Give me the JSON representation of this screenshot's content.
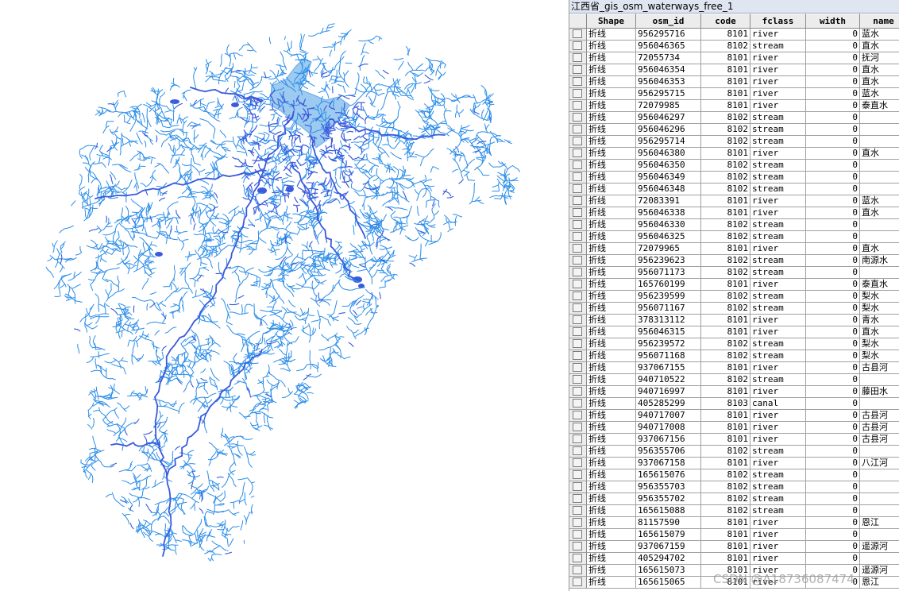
{
  "table": {
    "title": "江西省_gis_osm_waterways_free_1",
    "columns": [
      "Shape",
      "osm_id",
      "code",
      "fclass",
      "width",
      "name"
    ],
    "rows": [
      [
        "折线",
        "956295716",
        "8101",
        "river",
        "0",
        "蓝水"
      ],
      [
        "折线",
        "956046365",
        "8102",
        "stream",
        "0",
        "直水"
      ],
      [
        "折线",
        "72055734",
        "8101",
        "river",
        "0",
        "抚河"
      ],
      [
        "折线",
        "956046354",
        "8101",
        "river",
        "0",
        "直水"
      ],
      [
        "折线",
        "956046353",
        "8101",
        "river",
        "0",
        "直水"
      ],
      [
        "折线",
        "956295715",
        "8101",
        "river",
        "0",
        "蓝水"
      ],
      [
        "折线",
        "72079985",
        "8101",
        "river",
        "0",
        "泰直水"
      ],
      [
        "折线",
        "956046297",
        "8102",
        "stream",
        "0",
        ""
      ],
      [
        "折线",
        "956046296",
        "8102",
        "stream",
        "0",
        ""
      ],
      [
        "折线",
        "956295714",
        "8102",
        "stream",
        "0",
        ""
      ],
      [
        "折线",
        "956046380",
        "8101",
        "river",
        "0",
        "直水"
      ],
      [
        "折线",
        "956046350",
        "8102",
        "stream",
        "0",
        ""
      ],
      [
        "折线",
        "956046349",
        "8102",
        "stream",
        "0",
        ""
      ],
      [
        "折线",
        "956046348",
        "8102",
        "stream",
        "0",
        ""
      ],
      [
        "折线",
        "72083391",
        "8101",
        "river",
        "0",
        "蓝水"
      ],
      [
        "折线",
        "956046338",
        "8101",
        "river",
        "0",
        "直水"
      ],
      [
        "折线",
        "956046330",
        "8102",
        "stream",
        "0",
        ""
      ],
      [
        "折线",
        "956046325",
        "8102",
        "stream",
        "0",
        ""
      ],
      [
        "折线",
        "72079965",
        "8101",
        "river",
        "0",
        "直水"
      ],
      [
        "折线",
        "956239623",
        "8102",
        "stream",
        "0",
        "南源水"
      ],
      [
        "折线",
        "956071173",
        "8102",
        "stream",
        "0",
        ""
      ],
      [
        "折线",
        "165760199",
        "8101",
        "river",
        "0",
        "泰直水"
      ],
      [
        "折线",
        "956239599",
        "8102",
        "stream",
        "0",
        "梨水"
      ],
      [
        "折线",
        "956071167",
        "8102",
        "stream",
        "0",
        "梨水"
      ],
      [
        "折线",
        "378313112",
        "8101",
        "river",
        "0",
        "青水"
      ],
      [
        "折线",
        "956046315",
        "8101",
        "river",
        "0",
        "直水"
      ],
      [
        "折线",
        "956239572",
        "8102",
        "stream",
        "0",
        "梨水"
      ],
      [
        "折线",
        "956071168",
        "8102",
        "stream",
        "0",
        "梨水"
      ],
      [
        "折线",
        "937067155",
        "8101",
        "river",
        "0",
        "古县河"
      ],
      [
        "折线",
        "940710522",
        "8102",
        "stream",
        "0",
        ""
      ],
      [
        "折线",
        "940716997",
        "8101",
        "river",
        "0",
        "藤田水"
      ],
      [
        "折线",
        "405285299",
        "8103",
        "canal",
        "0",
        ""
      ],
      [
        "折线",
        "940717007",
        "8101",
        "river",
        "0",
        "古县河"
      ],
      [
        "折线",
        "940717008",
        "8101",
        "river",
        "0",
        "古县河"
      ],
      [
        "折线",
        "937067156",
        "8101",
        "river",
        "0",
        "古县河"
      ],
      [
        "折线",
        "956355706",
        "8102",
        "stream",
        "0",
        ""
      ],
      [
        "折线",
        "937067158",
        "8101",
        "river",
        "0",
        "八江河"
      ],
      [
        "折线",
        "165615076",
        "8102",
        "stream",
        "0",
        ""
      ],
      [
        "折线",
        "956355703",
        "8102",
        "stream",
        "0",
        ""
      ],
      [
        "折线",
        "956355702",
        "8102",
        "stream",
        "0",
        ""
      ],
      [
        "折线",
        "165615088",
        "8102",
        "stream",
        "0",
        ""
      ],
      [
        "折线",
        "81157590",
        "8101",
        "river",
        "0",
        "恩江"
      ],
      [
        "折线",
        "165615079",
        "8101",
        "river",
        "0",
        ""
      ],
      [
        "折线",
        "937067159",
        "8101",
        "river",
        "0",
        "遥源河"
      ],
      [
        "折线",
        "405294702",
        "8101",
        "river",
        "0",
        ""
      ],
      [
        "折线",
        "165615073",
        "8101",
        "river",
        "0",
        "遥源河"
      ],
      [
        "折线",
        "165615065",
        "8101",
        "river",
        "0",
        "恩江"
      ]
    ]
  },
  "map": {
    "colors": {
      "stream": "#2f8fe8",
      "river": "#3a5bdc",
      "lake": "#9ccaf0",
      "background": "#ffffff"
    }
  },
  "watermark": "CSDN @A18736087474"
}
